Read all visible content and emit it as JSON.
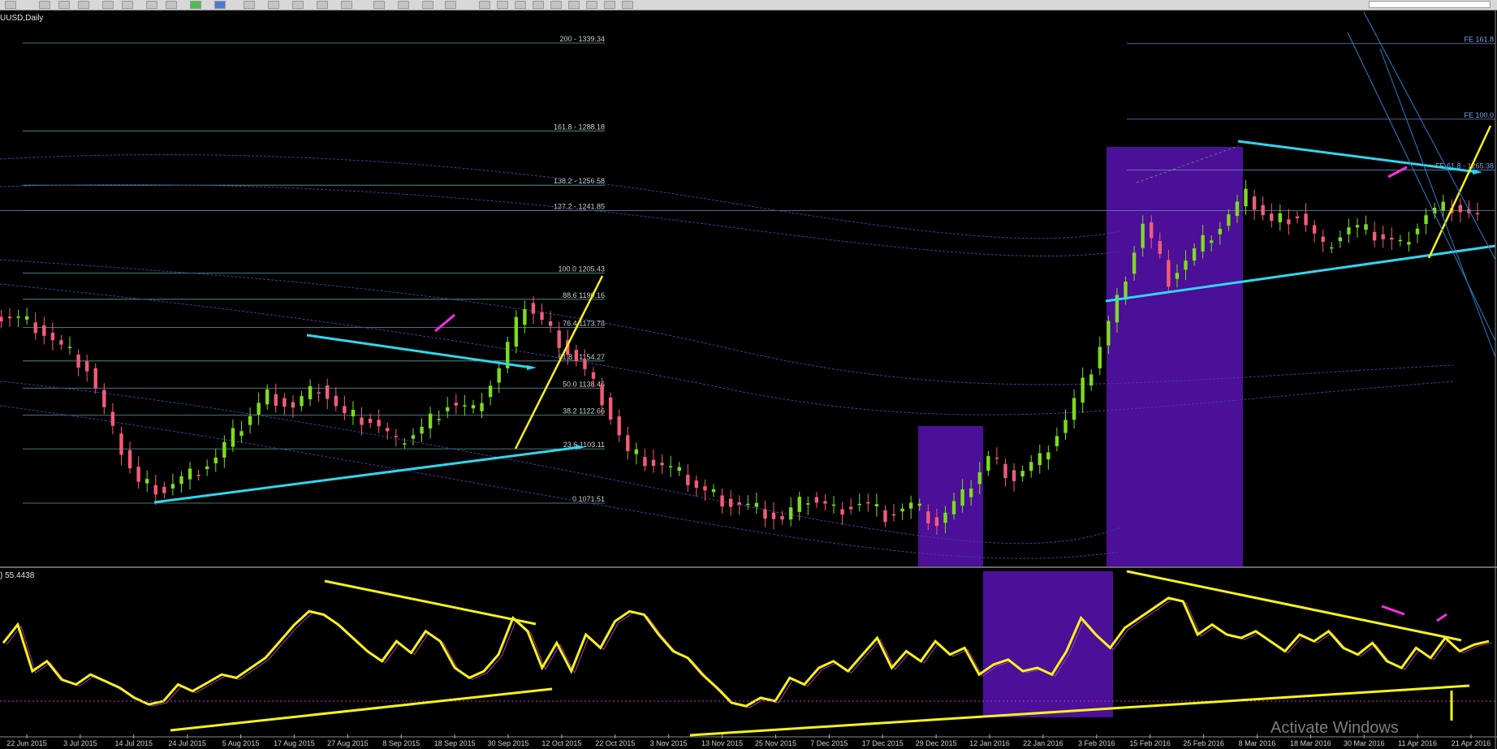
{
  "window": {
    "symbol_label": "UUSD,Daily",
    "oscillator_label": ") 55.4438"
  },
  "watermark": {
    "title": "Activate Windows",
    "subtitle": ""
  },
  "colors": {
    "background": "#000000",
    "bull_candle": "#7ddc1f",
    "bear_candle": "#f25c78",
    "fib_lines": "#5f9ea0",
    "fib_text": "#cfcfcf",
    "cyan_trend": "#30d6ee",
    "yellow": "#f7f21a",
    "magenta": "#ff2ee6",
    "purple_zone": "#4b0f98",
    "ma_blue": "#3f3fa0",
    "fe_lines": "#5f88c8"
  },
  "chart_data": [
    {
      "type": "candlestick",
      "title": "",
      "timeframe": "Daily",
      "x_tick_labels": [
        "22 Jun 2015",
        "3 Jul 2015",
        "14 Jul 2015",
        "24 Jul 2015",
        "5 Aug 2015",
        "17 Aug 2015",
        "27 Aug 2015",
        "8 Sep 2015",
        "18 Sep 2015",
        "30 Sep 2015",
        "12 Oct 2015",
        "22 Oct 2015",
        "3 Nov 2015",
        "13 Nov 2015",
        "25 Nov 2015",
        "7 Dec 2015",
        "17 Dec 2015",
        "29 Dec 2015",
        "12 Jan 2016",
        "22 Jan 2016",
        "3 Feb 2016",
        "15 Feb 2016",
        "25 Feb 2016",
        "8 Mar 2016",
        "18 Mar 2016",
        "30 Mar 2016",
        "11 Apr 2016",
        "21 Apr 2016"
      ],
      "fibonacci_levels_left": [
        {
          "label": "200 - 1339.34",
          "value": 1339.34
        },
        {
          "label": "161.8 - 1288.18",
          "value": 1288.18
        },
        {
          "label": "138.2 - 1256.58",
          "value": 1256.58
        },
        {
          "label": "127.2 - 1241.85",
          "value": 1241.85
        },
        {
          "label": "100.0 1205.43",
          "value": 1205.43
        },
        {
          "label": "88.6 1190.16",
          "value": 1190.16
        },
        {
          "label": "76.4 1173.78",
          "value": 1173.78
        },
        {
          "label": "61.8 - 1154.27",
          "value": 1154.27
        },
        {
          "label": "50.0 1138.46",
          "value": 1138.46
        },
        {
          "label": "38.2 1122.66",
          "value": 1122.66
        },
        {
          "label": "23.6 1103.11",
          "value": 1103.11
        },
        {
          "label": "0 1071.51",
          "value": 1071.51
        }
      ],
      "fibonacci_expansion_right": [
        {
          "label": "FE 161.8",
          "value": 1339
        },
        {
          "label": "FE 100.0",
          "value": 1295
        },
        {
          "label": "FE 61.8 - 1265.38",
          "value": 1265.38
        }
      ],
      "approx_close_path": [
        1180,
        1175,
        1162,
        1150,
        1112,
        1083,
        1080,
        1088,
        1098,
        1117,
        1135,
        1128,
        1140,
        1122,
        1120,
        1106,
        1115,
        1130,
        1125,
        1150,
        1188,
        1172,
        1155,
        1133,
        1100,
        1095,
        1088,
        1078,
        1072,
        1068,
        1062,
        1075,
        1068,
        1072,
        1065,
        1070,
        1060,
        1075,
        1098,
        1087,
        1097,
        1120,
        1150,
        1190,
        1235,
        1202,
        1218,
        1233,
        1250,
        1235,
        1240,
        1220,
        1232,
        1228,
        1222,
        1240,
        1245,
        1238
      ],
      "annotations": [
        "cyan descending trendline Aug-Sep 2015",
        "cyan ascending trendline Jul-Oct 2015",
        "cyan triangle Feb-Apr 2016",
        "yellow breakout arrows",
        "purple highlight zones Dec 2015-Jan 2016 and Feb-Mar 2016"
      ]
    },
    {
      "type": "line",
      "title": "",
      "indicator_value_label": ") 55.4438",
      "series": [
        {
          "values": [
            55,
            66,
            38,
            44,
            33,
            30,
            36,
            32,
            28,
            22,
            18,
            20,
            30,
            26,
            31,
            36,
            34,
            40,
            46,
            56,
            66,
            74,
            72,
            66,
            58,
            50,
            44,
            56,
            49,
            62,
            56,
            40,
            34,
            38,
            48,
            70,
            62,
            40,
            55,
            38,
            60,
            52,
            68,
            74,
            72,
            60,
            50,
            46,
            36,
            28,
            19,
            17,
            22,
            20,
            34,
            30,
            40,
            44,
            38,
            48,
            58,
            40,
            50,
            44,
            56,
            48,
            52,
            36,
            42,
            45,
            38,
            40,
            36,
            50,
            70,
            60,
            52,
            64,
            70,
            76,
            82,
            80,
            60,
            66,
            60,
            58,
            62,
            56,
            50,
            60,
            56,
            62,
            52,
            48,
            55,
            44,
            40,
            52,
            46,
            58,
            50,
            54,
            56
          ]
        }
      ],
      "annotations": [
        "yellow converging trendlines",
        "magenta divergence arrows"
      ]
    }
  ]
}
